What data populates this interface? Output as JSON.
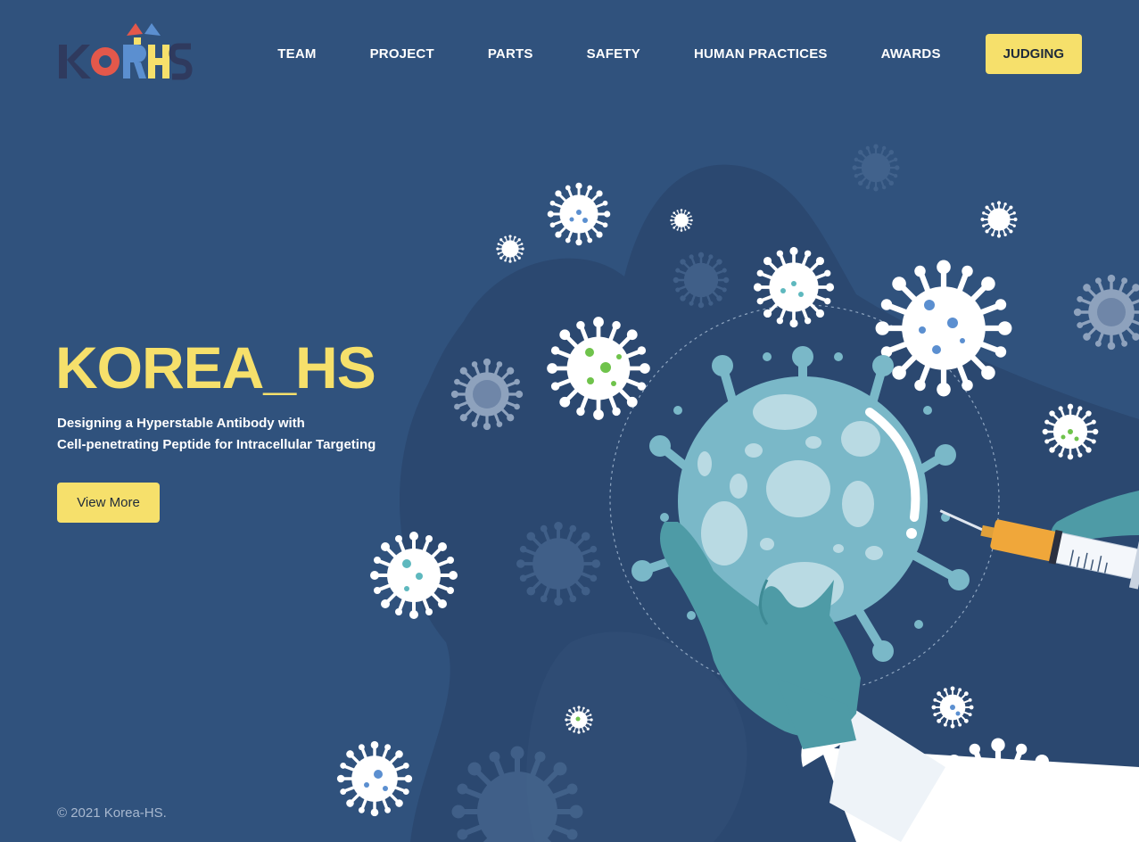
{
  "brand": {
    "logo_text": "KORHS",
    "colors": {
      "navy": "#2f3a5e",
      "red": "#e3584b",
      "blue": "#5b8fd0",
      "yellow": "#f6e06b"
    }
  },
  "nav": {
    "items": [
      {
        "label": "TEAM"
      },
      {
        "label": "PROJECT"
      },
      {
        "label": "PARTS"
      },
      {
        "label": "SAFETY"
      },
      {
        "label": "HUMAN PRACTICES"
      },
      {
        "label": "AWARDS"
      }
    ],
    "judging_label": "JUDGING"
  },
  "hero": {
    "title": "KOREA_HS",
    "subtitle_line1": "Designing a Hyperstable Antibody with",
    "subtitle_line2": "Cell-penetrating Peptide for Intracellular Targeting",
    "cta_label": "View More"
  },
  "footer": {
    "copyright": "© 2021 Korea-HS."
  },
  "theme": {
    "background": "#30527d",
    "blob": "#2b4870",
    "accent": "#f6e06b",
    "virus_teal": "#7ab8c8",
    "glove": "#4e9ba6"
  },
  "illustration": {
    "icons": [
      "virus-icon",
      "gloved-hand-icon",
      "syringe-icon",
      "lab-coat-sleeve-icon"
    ]
  }
}
